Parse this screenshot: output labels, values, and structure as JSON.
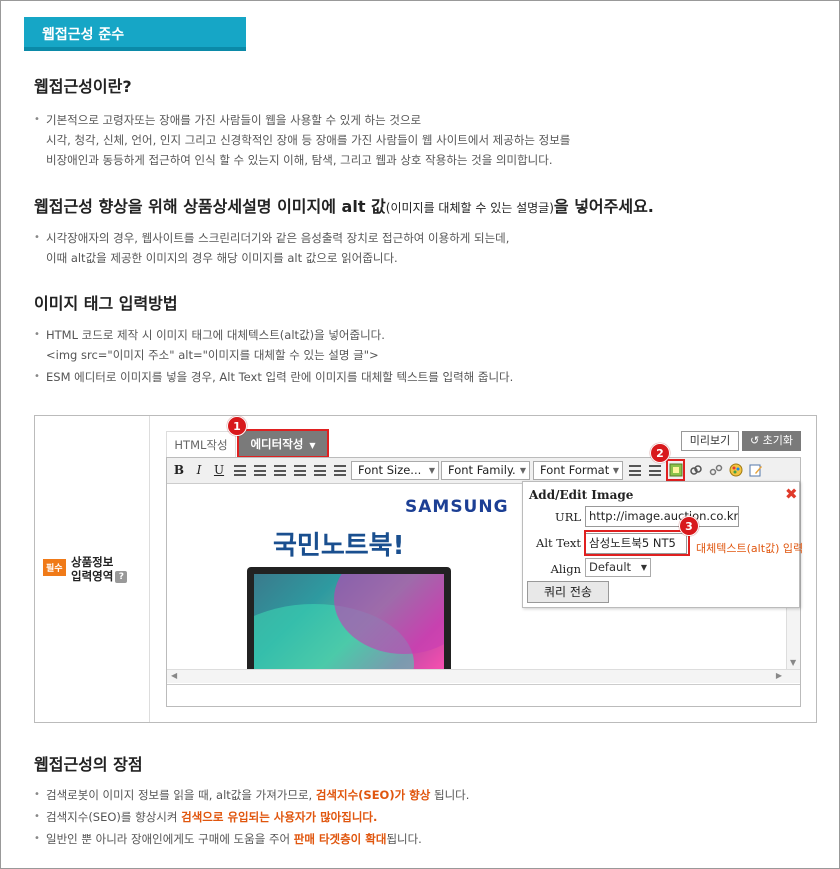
{
  "banner": {
    "title": "웹접근성 준수"
  },
  "section1": {
    "title": "웹접근성이란?",
    "lines": [
      "기본적으로 고령자또는 장애를 가진 사람들이 웹을 사용할 수 있게 하는 것으로",
      "시각, 청각, 신체, 언어, 인지 그리고 신경학적인 장애 등 장애를 가진 사람들이 웹 사이트에서 제공하는 정보를",
      "비장애인과 동등하게 접근하여 인식 할 수 있는지 이해, 탐색, 그리고 웹과 상호 작용하는 것을 의미합니다."
    ]
  },
  "section2": {
    "title_a": "웹접근성 향상을 위해 상품상세설명 이미지에 alt 값",
    "title_small": "(이미지를 대체할 수 있는 설명글)",
    "title_b": "을 넣어주세요.",
    "lines": [
      "시각장애자의 경우, 웹사이트를 스크린리더기와 같은 음성출력 장치로 접근하여 이용하게 되는데,",
      "이때 alt값을 제공한 이미지의 경우 해당 이미지를 alt 값으로 읽어줍니다."
    ]
  },
  "section3": {
    "title": "이미지 태그 입력방법",
    "bullet1": [
      "HTML 코드로 제작 시 이미지 태그에 대체텍스트(alt값)을 넣어줍니다.",
      "<img src=\"이미지 주소\" alt=\"이미지를 대체할 수 있는 설명 글\">"
    ],
    "bullet2": "ESM 에디터로 이미지를 넣을 경우, Alt Text 입력 란에 이미지를 대체할 텍스트를 입력해 줍니다."
  },
  "form": {
    "required_badge": "필수",
    "field_label_1": "상품정보",
    "field_label_2": "입력영역",
    "help": "?"
  },
  "editor": {
    "tab_html": "HTML작성",
    "tab_editor": "에디터작성",
    "preview": "미리보기",
    "reset": "초기화",
    "reset_icon": "↺",
    "badges": [
      "1",
      "2",
      "3"
    ],
    "toolbar": {
      "bold": "B",
      "italic": "I",
      "underline": "U",
      "font_size": "Font Size...",
      "font_family": "Font Family.",
      "font_format": "Font Format"
    },
    "content": {
      "brand": "SAMSUNG",
      "headline": "국민노트북!"
    }
  },
  "dialog": {
    "title": "Add/Edit Image",
    "close": "✖",
    "url_label": "URL",
    "url_value": "http://image.auction.co.kr",
    "alt_label": "Alt Text",
    "alt_value": "삼성노트북5 NT5",
    "align_label": "Align",
    "align_value": "Default",
    "submit": "쿼리 전송",
    "alt_note": "대체텍스트(alt값) 입력"
  },
  "section4": {
    "title": "웹접근성의 장점",
    "l1_a": "검색로봇이 이미지 정보를 읽을 때, alt값을 가져가므로, ",
    "l1_hl": "검색지수(SEO)가 향상",
    "l1_b": " 됩니다.",
    "l2_a": "검색지수(SEO)를 향상시켜 ",
    "l2_hl": "검색으로 유입되는 사용자가 많아집니다.",
    "l3_a": "일반인 뿐 아니라 장애인에게도 구매에 도움을 주어 ",
    "l3_hl": "판매 타겟층이 확대",
    "l3_b": "됩니다."
  },
  "colors": {
    "banner": "#16a6c6",
    "highlight": "#e0560e",
    "marker": "#e02020"
  }
}
